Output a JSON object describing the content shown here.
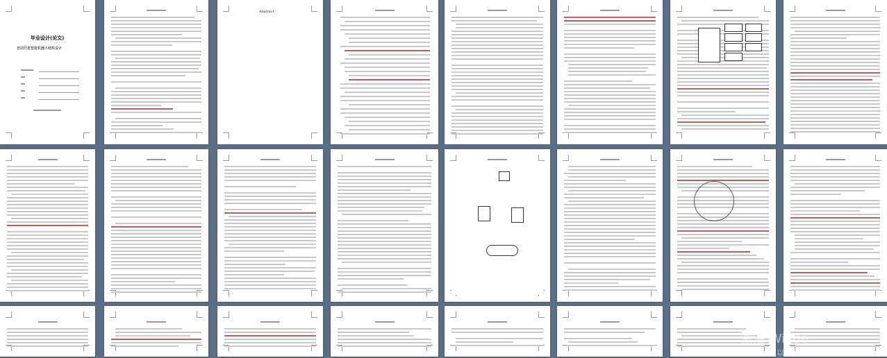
{
  "title_page": {
    "heading": "毕业设计(论文)",
    "subtitle": "自动行走智能机器人结构设计"
  },
  "abstract_page": {
    "heading": "Abstract"
  },
  "activation_notice": {
    "line1": "激活 Windo",
    "line2": "转到\"设置\"以激活 Windows"
  }
}
